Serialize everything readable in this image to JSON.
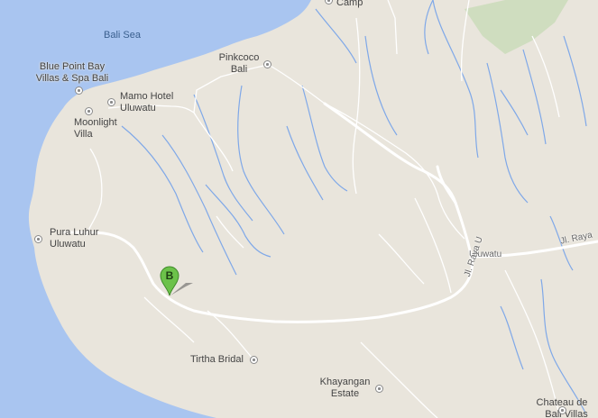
{
  "map": {
    "sea_label": "Bali Sea",
    "roads": {
      "uluwatu_road": "Uluwatu",
      "jl_raya_uluwatu_vertical": "Jl. Raya U",
      "jl_raya_east": "Jl. Raya"
    },
    "places": {
      "camp": "Camp",
      "blue_point_line1": "Blue Point Bay",
      "blue_point_line2": "Villas & Spa Bali",
      "pinkcoco_line1": "Pinkcoco",
      "pinkcoco_line2": "Bali",
      "mamo_line1": "Mamo Hotel",
      "mamo_line2": "Uluwatu",
      "moonlight_line1": "Moonlight",
      "moonlight_line2": "Villa",
      "pura_line1": "Pura Luhur",
      "pura_line2": "Uluwatu",
      "tirtha": "Tirtha Bridal",
      "khayangan_line1": "Khayangan",
      "khayangan_line2": "Estate",
      "chateau_line1": "Chateau de",
      "chateau_line2": "Bali Villas"
    },
    "marker": {
      "letter": "B",
      "color": "#6cc24a"
    },
    "colors": {
      "sea": "#a9c5f0",
      "land": "#e9e5dc",
      "park": "#cfddbf",
      "river": "#7fa8e8",
      "road": "#ffffff"
    }
  }
}
